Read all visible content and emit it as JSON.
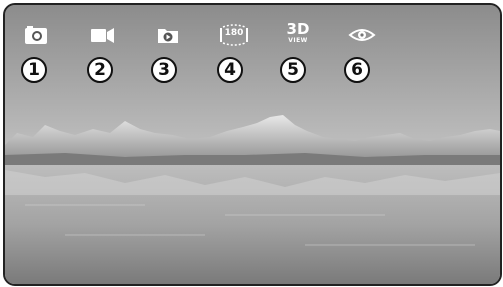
{
  "toolbar": {
    "buttons": [
      {
        "icon": "photo-camera-icon",
        "number": "1"
      },
      {
        "icon": "video-camera-icon",
        "number": "2"
      },
      {
        "icon": "playback-folder-icon",
        "number": "3"
      },
      {
        "icon": "panorama-180-icon",
        "label": "180",
        "number": "4"
      },
      {
        "icon": "view-3d-icon",
        "label_big": "3D",
        "label_small": "VIEW",
        "number": "5"
      },
      {
        "icon": "eye-icon",
        "number": "6"
      }
    ]
  },
  "colors": {
    "icon": "#ffffff",
    "badge_background": "#ffffff",
    "badge_text": "#111111"
  }
}
